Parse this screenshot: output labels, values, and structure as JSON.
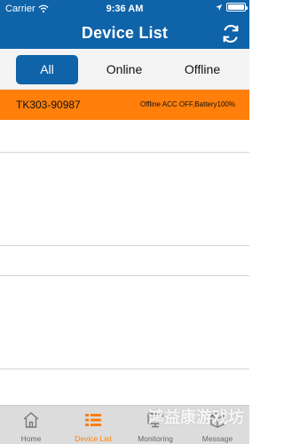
{
  "status_bar": {
    "carrier": "Carrier",
    "time": "9:36 AM"
  },
  "header": {
    "title": "Device List",
    "refresh_icon": "refresh-icon"
  },
  "segment": {
    "tabs": [
      "All",
      "Online",
      "Offline"
    ],
    "selected": "All"
  },
  "devices": [
    {
      "name": "TK303-90987",
      "status": "Offline ACC OFF,Battery100%"
    }
  ],
  "tab_bar": {
    "items": [
      {
        "label": "Home",
        "icon": "home-icon"
      },
      {
        "label": "Device List",
        "icon": "list-icon"
      },
      {
        "label": "Monitoring",
        "icon": "monitor-icon"
      },
      {
        "label": "Message",
        "icon": "message-icon"
      }
    ],
    "selected": "Device List"
  },
  "watermark": "鸿益康游戏坊",
  "colors": {
    "header": "#0f63a9",
    "accent": "#ff7f0a",
    "tabbar_bg": "#dcdcdc"
  }
}
